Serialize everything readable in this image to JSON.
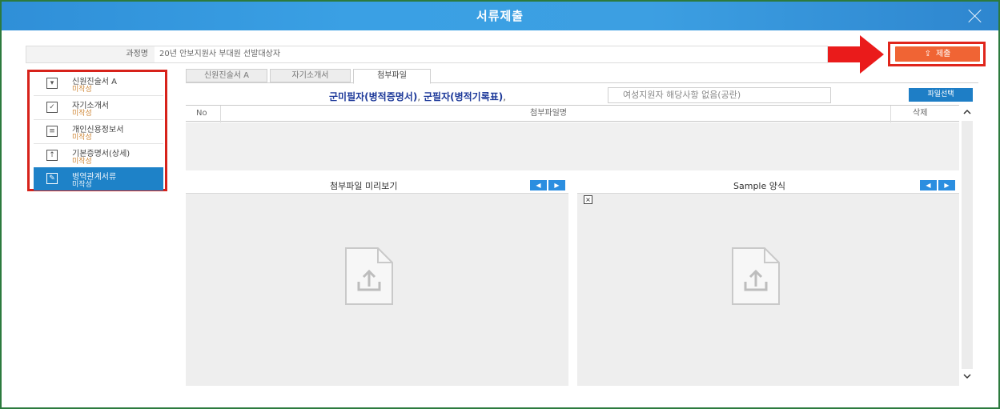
{
  "window": {
    "title": "서류제출"
  },
  "course": {
    "label": "과정명",
    "value": "20년 안보지원사 부대원 선발대상자"
  },
  "submit": {
    "label": "제출"
  },
  "sidebar": {
    "items": [
      {
        "name": "신원진술서 A",
        "status": "미작성",
        "icon": "document-shield-icon"
      },
      {
        "name": "자기소개서",
        "status": "미작성",
        "icon": "check-box-icon"
      },
      {
        "name": "개인신용정보서",
        "status": "미작성",
        "icon": "list-doc-icon"
      },
      {
        "name": "기본증명서(상세)",
        "status": "미작성",
        "icon": "upload-box-icon"
      },
      {
        "name": "병역관계서류",
        "status": "미작성",
        "icon": "edit-icon"
      }
    ]
  },
  "tabs": [
    {
      "label": "신원진술서 A"
    },
    {
      "label": "자기소개서"
    },
    {
      "label": "첨부파일"
    }
  ],
  "notice": {
    "part1": "군미필자(병적증명서)",
    "sep1": ", ",
    "part2": "군필자(병적기록표)",
    "sep2": ","
  },
  "no_item_option": {
    "label": "여성지원자 해당사항 없음(공란)"
  },
  "file_select": {
    "label": "파일선택"
  },
  "grid": {
    "columns": [
      "No",
      "첨부파일명",
      "삭제"
    ]
  },
  "preview": {
    "title": "첨부파일 미리보기"
  },
  "sample": {
    "title": "Sample 양식"
  },
  "colors": {
    "accent": "#1e82c8",
    "submit": "#f06434",
    "highlight": "#e0261c",
    "status": "#d08a3c"
  }
}
